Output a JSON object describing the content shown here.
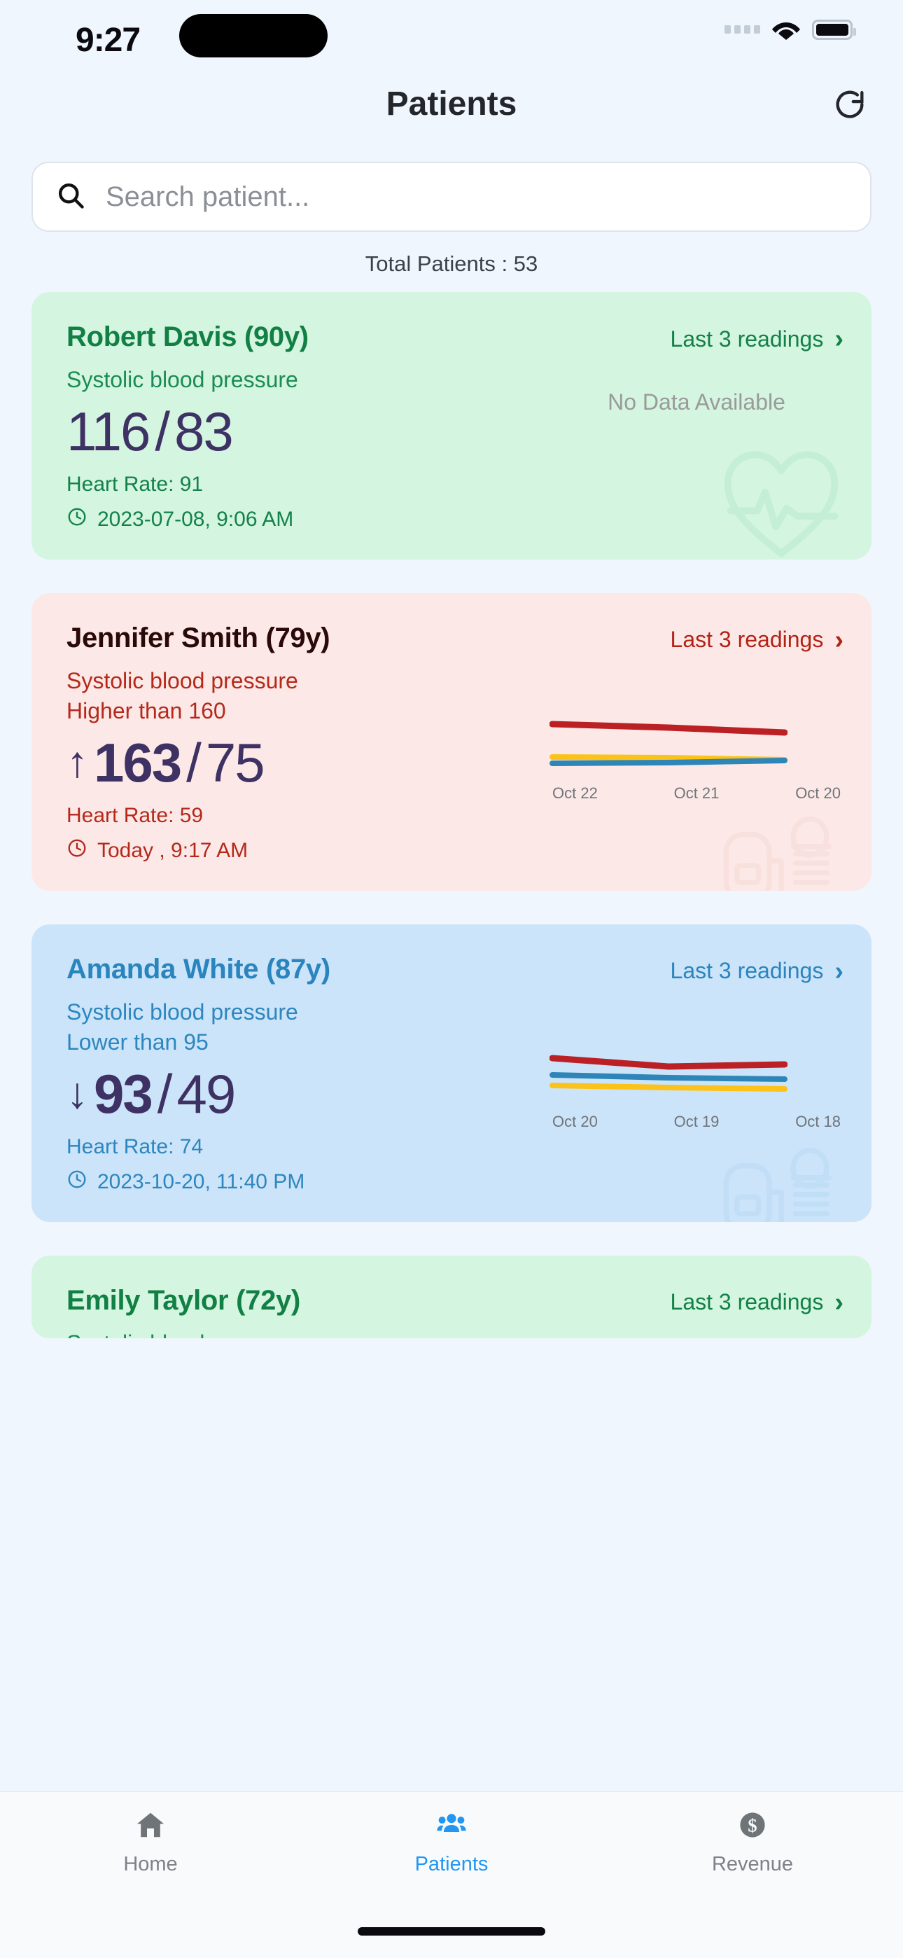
{
  "status_bar": {
    "time": "9:27",
    "icons": [
      "signal-dots-icon",
      "wifi-icon",
      "battery-icon"
    ]
  },
  "header": {
    "title": "Patients",
    "refresh_icon": "refresh-icon"
  },
  "search": {
    "placeholder": "Search patient...",
    "value": "",
    "icon": "search-icon"
  },
  "summary": {
    "total_patients_label": "Total Patients : 53"
  },
  "colors": {
    "page_bg": "#eff6fd",
    "card_green": "#d4f5e0",
    "card_red": "#fce9e7",
    "card_blue": "#cbe4f9",
    "bp_value": "#3e3163",
    "accent_blue": "#2196f3",
    "green_text": "#128045",
    "red_text": "#b32216",
    "blue_text": "#2a84be",
    "line_systolic": "#bb2025",
    "line_diastolic": "#fbc319",
    "line_heartrate": "#2e85b8"
  },
  "readings_link_label": "Last 3 readings",
  "patients": [
    {
      "name": "Robert Davis (90y)",
      "status": "green",
      "metric_label": "Systolic blood pressure",
      "threshold_label": "",
      "trend_arrow": "",
      "systolic": "116",
      "separator": "/",
      "diastolic": "83",
      "heart_rate_label": "Heart Rate: 91",
      "timestamp": "2023-07-08, 9:06 AM",
      "chart_empty_label": "No Data Available",
      "watermark_icon": "heart-pulse-icon",
      "has_chart": false
    },
    {
      "name": "Jennifer Smith (79y)",
      "status": "red",
      "metric_label": "Systolic blood pressure",
      "threshold_label": "Higher than 160",
      "trend_arrow": "↑",
      "systolic": "163",
      "separator": "/",
      "diastolic": "75",
      "heart_rate_label": "Heart Rate: 59",
      "timestamp": "Today , 9:17 AM",
      "chart_empty_label": "",
      "watermark_icon": "bp-monitor-icon",
      "has_chart": true
    },
    {
      "name": "Amanda White (87y)",
      "status": "blue",
      "metric_label": "Systolic blood pressure",
      "threshold_label": "Lower than 95",
      "trend_arrow": "↓",
      "systolic": "93",
      "separator": "/",
      "diastolic": "49",
      "heart_rate_label": "Heart Rate: 74",
      "timestamp": "2023-10-20, 11:40 PM",
      "chart_empty_label": "",
      "watermark_icon": "bp-monitor-icon",
      "has_chart": true
    },
    {
      "name": "Emily Taylor (72y)",
      "status": "green",
      "metric_label": "Systolic blood pressure",
      "threshold_label": "",
      "trend_arrow": "",
      "systolic": "",
      "separator": "",
      "diastolic": "",
      "heart_rate_label": "",
      "timestamp": "",
      "chart_empty_label": "",
      "watermark_icon": "",
      "has_chart": false
    }
  ],
  "chart_data": [
    {
      "type": "line",
      "patient": "Jennifer Smith (79y)",
      "x": [
        "Oct 22",
        "Oct 21",
        "Oct 20"
      ],
      "xlabel": "",
      "ylabel": "",
      "ylim": [
        40,
        180
      ],
      "grid": false,
      "legend": "none",
      "series": [
        {
          "name": "Systolic",
          "color": "#bb2025",
          "values": [
            163,
            158,
            152
          ]
        },
        {
          "name": "Diastolic",
          "color": "#fbc319",
          "values": [
            75,
            76,
            78
          ]
        },
        {
          "name": "Heart Rate",
          "color": "#2e85b8",
          "values": [
            59,
            63,
            72
          ]
        }
      ]
    },
    {
      "type": "line",
      "patient": "Amanda White (87y)",
      "x": [
        "Oct 20",
        "Oct 19",
        "Oct 18"
      ],
      "xlabel": "",
      "ylabel": "",
      "ylim": [
        40,
        180
      ],
      "grid": false,
      "legend": "none",
      "series": [
        {
          "name": "Systolic",
          "color": "#bb2025",
          "values": [
            93,
            86,
            89
          ]
        },
        {
          "name": "Heart Rate",
          "color": "#2e85b8",
          "values": [
            74,
            72,
            71
          ]
        },
        {
          "name": "Diastolic",
          "color": "#fbc319",
          "values": [
            49,
            47,
            46
          ]
        }
      ]
    }
  ],
  "bottom_nav": {
    "items": [
      {
        "label": "Home",
        "icon": "home-icon",
        "active": false
      },
      {
        "label": "Patients",
        "icon": "people-icon",
        "active": true
      },
      {
        "label": "Revenue",
        "icon": "dollar-coin-icon",
        "active": false
      }
    ]
  }
}
